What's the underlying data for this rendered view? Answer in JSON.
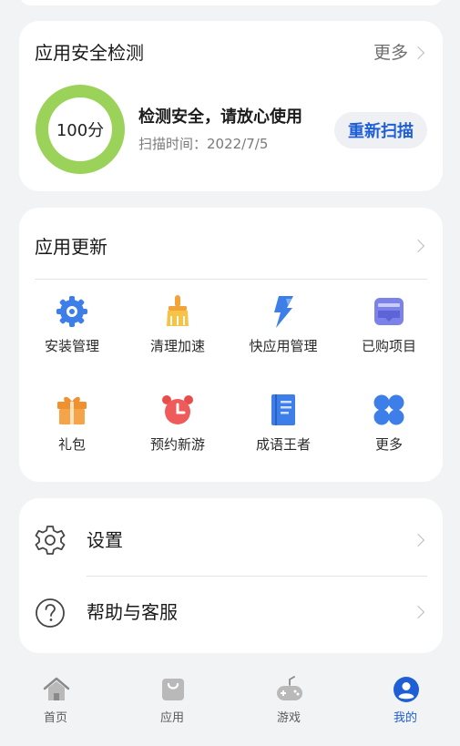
{
  "security": {
    "title": "应用安全检测",
    "more_label": "更多",
    "score": "100分",
    "score_value": 100,
    "status": "检测安全，请放心使用",
    "scan_time": "扫描时间：2022/7/5",
    "rescan_label": "重新扫描",
    "ring_color": "#9ad25a",
    "accent_color": "#1f5fd6"
  },
  "update": {
    "title": "应用更新",
    "items": [
      {
        "label": "安装管理",
        "icon": "gear-icon"
      },
      {
        "label": "清理加速",
        "icon": "broom-icon"
      },
      {
        "label": "快应用管理",
        "icon": "lightning-icon"
      },
      {
        "label": "已购项目",
        "icon": "purchased-icon"
      },
      {
        "label": "礼包",
        "icon": "gift-icon"
      },
      {
        "label": "预约新游",
        "icon": "alarm-clock-icon"
      },
      {
        "label": "成语王者",
        "icon": "book-icon"
      },
      {
        "label": "更多",
        "icon": "four-leaf-icon"
      }
    ]
  },
  "settings": {
    "items": [
      {
        "label": "设置",
        "icon": "settings-gear-icon"
      },
      {
        "label": "帮助与客服",
        "icon": "help-icon"
      }
    ]
  },
  "nav": {
    "items": [
      {
        "label": "首页",
        "icon": "home-icon",
        "active": false
      },
      {
        "label": "应用",
        "icon": "app-bag-icon",
        "active": false
      },
      {
        "label": "游戏",
        "icon": "gamepad-icon",
        "active": false
      },
      {
        "label": "我的",
        "icon": "profile-icon",
        "active": true
      }
    ]
  }
}
